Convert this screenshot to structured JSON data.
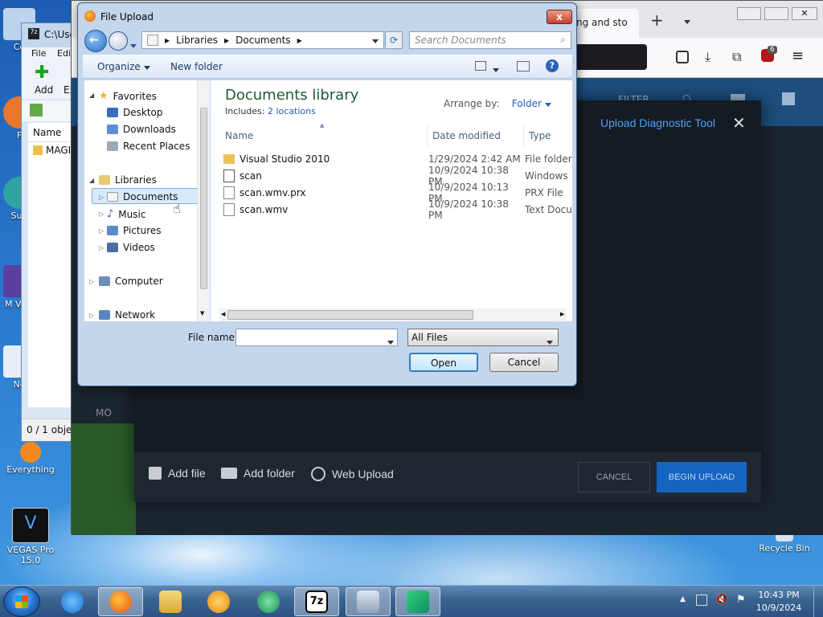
{
  "desktop": {
    "icons": [
      {
        "label": "Co"
      },
      {
        "label": "F"
      },
      {
        "label": "Sup"
      },
      {
        "label": "M Visu"
      },
      {
        "label": "No"
      },
      {
        "label": "Everything"
      },
      {
        "label": "VEGAS Pro 15.0"
      },
      {
        "label": "Recycle Bin"
      }
    ]
  },
  "zip": {
    "title": "C:\\Use",
    "menu": [
      "File",
      "Edi"
    ],
    "add_label": "Add",
    "ex_label": "Ex",
    "col_name": "Name",
    "row": "MAGI",
    "status": "0 / 1 objec"
  },
  "firefox": {
    "tab_title": "ng and sto",
    "new_tab": "+",
    "menu_glyph": "≡",
    "badge_count": "6",
    "page_header": {
      "filter": "FILTER"
    },
    "left_stub": "MO"
  },
  "upload_modal": {
    "title": "Upload Diagnostic Tool",
    "close": "✕",
    "add_file": "Add file",
    "add_folder": "Add folder",
    "web_upload": "Web Upload",
    "cancel": "CANCEL",
    "begin_upload": "BEGIN UPLOAD"
  },
  "dialog": {
    "title": "File Upload",
    "close": "x",
    "breadcrumb": [
      "Libraries",
      "Documents"
    ],
    "search_placeholder": "Search Documents",
    "organize": "Organize",
    "new_folder": "New folder",
    "nav": {
      "favorites": "Favorites",
      "desktop": "Desktop",
      "downloads": "Downloads",
      "recent_places": "Recent Places",
      "libraries": "Libraries",
      "documents": "Documents",
      "music": "Music",
      "pictures": "Pictures",
      "videos": "Videos",
      "computer": "Computer",
      "network": "Network"
    },
    "library_title": "Documents library",
    "includes_label": "Includes:",
    "includes_link": "2 locations",
    "arrange_by": "Arrange by:",
    "arrange_value": "Folder",
    "columns": {
      "name": "Name",
      "date": "Date modified",
      "type": "Type"
    },
    "files": [
      {
        "name": "Visual Studio 2010",
        "date": "1/29/2024 2:42 AM",
        "type": "File folder",
        "icon": "folder-icon"
      },
      {
        "name": "scan",
        "date": "10/9/2024 10:38 PM",
        "type": "Windows",
        "icon": "media-file-icon"
      },
      {
        "name": "scan.wmv.prx",
        "date": "10/9/2024 10:13 PM",
        "type": "PRX File",
        "icon": "file-icon"
      },
      {
        "name": "scan.wmv",
        "date": "10/9/2024 10:38 PM",
        "type": "Text Docu",
        "icon": "text-file-icon"
      }
    ],
    "file_name_label": "File name:",
    "file_name_value": "",
    "file_type_value": "All Files",
    "open": "Open",
    "cancel": "Cancel"
  },
  "taskbar": {
    "time": "10:43 PM",
    "date": "10/9/2024",
    "apps": [
      "ie",
      "firefox",
      "explorer",
      "media-player",
      "app-green",
      "7zip",
      "app-window",
      "app-cube"
    ]
  },
  "colors": {
    "accent": "#1565c0",
    "title_link": "#4aa3ff",
    "library_green": "#1e5a35"
  }
}
